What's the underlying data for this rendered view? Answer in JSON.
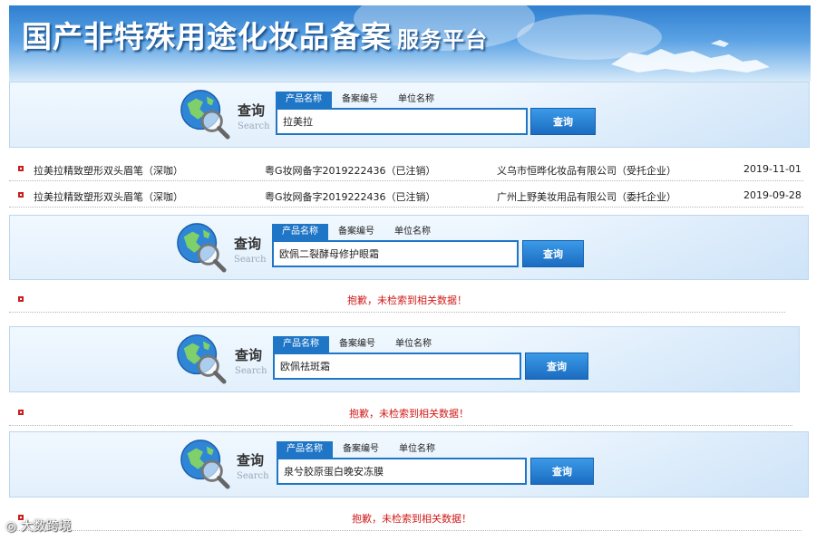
{
  "header": {
    "title": "国产非特殊用途化妆品备案",
    "subtitle": "服务平台"
  },
  "search_label": {
    "cn": "查询",
    "en": "Search"
  },
  "tabs": [
    "产品名称",
    "备案编号",
    "单位名称"
  ],
  "search_button": "查询",
  "panels": [
    {
      "query": "拉美拉"
    },
    {
      "query": "欧佩二裂酵母修护眼霜"
    },
    {
      "query": "欧佩祛斑霜"
    },
    {
      "query": "泉兮胶原蛋白晚安冻膜"
    }
  ],
  "results": [
    {
      "product": "拉美拉精致塑形双头眉笔（深咖）",
      "record_no": "粤G妆网备字2019222436（已注销）",
      "company": "义乌市恒晔化妆品有限公司（受托企业）",
      "date": "2019-11-01"
    },
    {
      "product": "拉美拉精致塑形双头眉笔（深咖）",
      "record_no": "粤G妆网备字2019222436（已注销）",
      "company": "广州上野美妆用品有限公司（委托企业）",
      "date": "2019-09-28"
    }
  ],
  "no_result_message": "抱歉，未检索到相关数据！",
  "watermark": "大数跨境",
  "colors": {
    "accent": "#1f76c6",
    "error": "#d01a1a"
  }
}
